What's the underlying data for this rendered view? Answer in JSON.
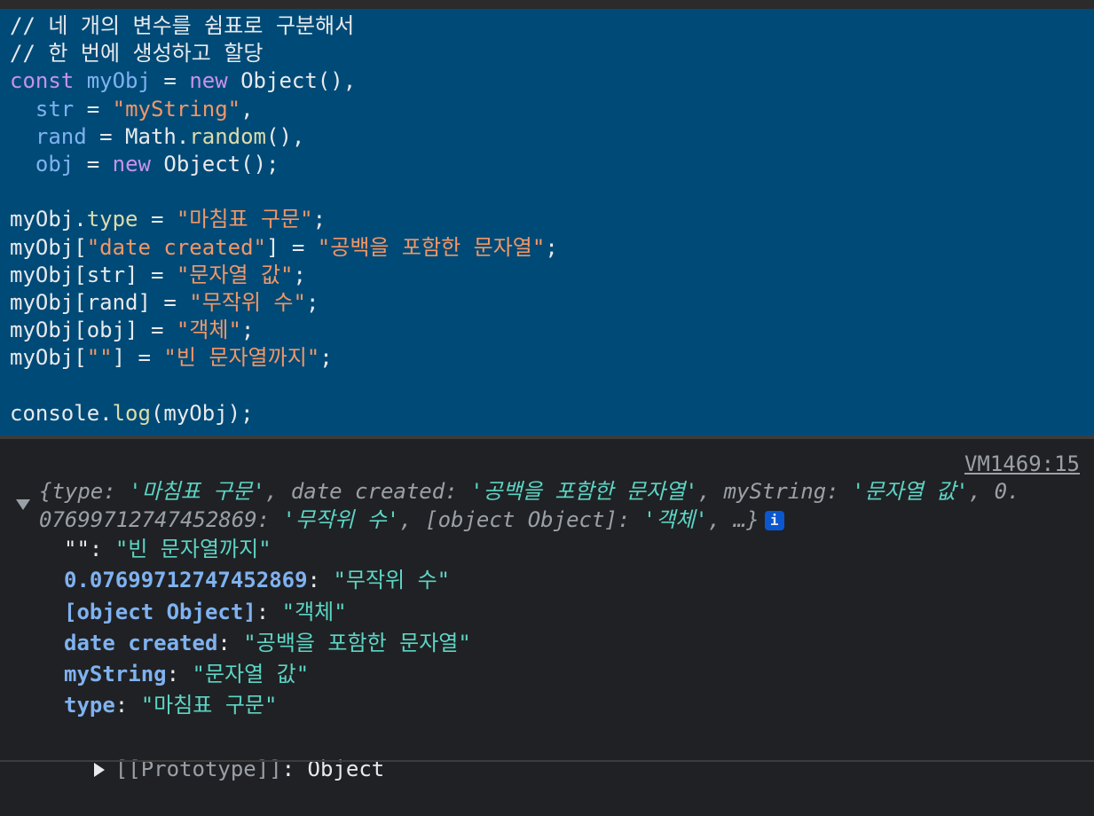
{
  "editor": {
    "lines": [
      [
        {
          "c": "cm",
          "t": "// 네 개의 변수를 쉼표로 구분해서"
        }
      ],
      [
        {
          "c": "cm",
          "t": "// 한 번에 생성하고 할당"
        }
      ],
      [
        {
          "c": "kw",
          "t": "const "
        },
        {
          "c": "var",
          "t": "myObj"
        },
        {
          "c": "plain",
          "t": " = "
        },
        {
          "c": "kw",
          "t": "new "
        },
        {
          "c": "plain",
          "t": "Object(),"
        }
      ],
      [
        {
          "c": "plain",
          "t": "  "
        },
        {
          "c": "var",
          "t": "str"
        },
        {
          "c": "plain",
          "t": " = "
        },
        {
          "c": "str",
          "t": "\"myString\""
        },
        {
          "c": "plain",
          "t": ","
        }
      ],
      [
        {
          "c": "plain",
          "t": "  "
        },
        {
          "c": "var",
          "t": "rand"
        },
        {
          "c": "plain",
          "t": " = Math."
        },
        {
          "c": "fn",
          "t": "random"
        },
        {
          "c": "plain",
          "t": "(),"
        }
      ],
      [
        {
          "c": "plain",
          "t": "  "
        },
        {
          "c": "var",
          "t": "obj"
        },
        {
          "c": "plain",
          "t": " = "
        },
        {
          "c": "kw",
          "t": "new "
        },
        {
          "c": "plain",
          "t": "Object();"
        }
      ],
      [
        {
          "c": "plain",
          "t": ""
        }
      ],
      [
        {
          "c": "plain",
          "t": "myObj."
        },
        {
          "c": "fn",
          "t": "type"
        },
        {
          "c": "plain",
          "t": " = "
        },
        {
          "c": "str",
          "t": "\"마침표 구문\""
        },
        {
          "c": "plain",
          "t": ";"
        }
      ],
      [
        {
          "c": "plain",
          "t": "myObj["
        },
        {
          "c": "str",
          "t": "\"date created\""
        },
        {
          "c": "plain",
          "t": "] = "
        },
        {
          "c": "str",
          "t": "\"공백을 포함한 문자열\""
        },
        {
          "c": "plain",
          "t": ";"
        }
      ],
      [
        {
          "c": "plain",
          "t": "myObj[str] = "
        },
        {
          "c": "str",
          "t": "\"문자열 값\""
        },
        {
          "c": "plain",
          "t": ";"
        }
      ],
      [
        {
          "c": "plain",
          "t": "myObj[rand] = "
        },
        {
          "c": "str",
          "t": "\"무작위 수\""
        },
        {
          "c": "plain",
          "t": ";"
        }
      ],
      [
        {
          "c": "plain",
          "t": "myObj[obj] = "
        },
        {
          "c": "str",
          "t": "\"객체\""
        },
        {
          "c": "plain",
          "t": ";"
        }
      ],
      [
        {
          "c": "plain",
          "t": "myObj["
        },
        {
          "c": "str",
          "t": "\"\""
        },
        {
          "c": "plain",
          "t": "] = "
        },
        {
          "c": "str",
          "t": "\"빈 문자열까지\""
        },
        {
          "c": "plain",
          "t": ";"
        }
      ],
      [
        {
          "c": "plain",
          "t": ""
        }
      ],
      [
        {
          "c": "plain",
          "t": "console."
        },
        {
          "c": "fn",
          "t": "log"
        },
        {
          "c": "plain",
          "t": "(myObj);"
        }
      ]
    ]
  },
  "console": {
    "source_link": "VM1469:15",
    "summary_line1": [
      {
        "c": "it",
        "t": "{"
      },
      {
        "c": "ik",
        "t": "type"
      },
      {
        "c": "it",
        "t": ": "
      },
      {
        "c": "is",
        "t": "'마침표 구문'"
      },
      {
        "c": "it",
        "t": ", "
      },
      {
        "c": "ik",
        "t": "date created"
      },
      {
        "c": "it",
        "t": ": "
      },
      {
        "c": "is",
        "t": "'공백을 포함한 문자열'"
      },
      {
        "c": "it",
        "t": ", "
      },
      {
        "c": "ik",
        "t": "myString"
      },
      {
        "c": "it",
        "t": ": "
      },
      {
        "c": "is",
        "t": "'문자열 값'"
      },
      {
        "c": "it",
        "t": ", 0."
      }
    ],
    "summary_line2": [
      {
        "c": "ik",
        "t": "07699712747452869"
      },
      {
        "c": "it",
        "t": ": "
      },
      {
        "c": "is",
        "t": "'무작위 수'"
      },
      {
        "c": "it",
        "t": ", "
      },
      {
        "c": "ik",
        "t": "[object Object]"
      },
      {
        "c": "it",
        "t": ": "
      },
      {
        "c": "is",
        "t": "'객체'"
      },
      {
        "c": "it",
        "t": ", …}"
      }
    ],
    "info_badge": "i",
    "properties": [
      {
        "key": "\"\"",
        "quoted": true,
        "value": "\"빈 문자열까지\""
      },
      {
        "key": "0.07699712747452869",
        "quoted": false,
        "value": "\"무작위 수\""
      },
      {
        "key": "[object Object]",
        "quoted": false,
        "value": "\"객체\""
      },
      {
        "key": "date created",
        "quoted": false,
        "value": "\"공백을 포함한 문자열\""
      },
      {
        "key": "myString",
        "quoted": false,
        "value": "\"문자열 값\""
      },
      {
        "key": "type",
        "quoted": false,
        "value": "\"마침표 구문\""
      }
    ],
    "prototype_key": "[[Prototype]]",
    "prototype_sep": ": ",
    "prototype_value": "Object"
  }
}
